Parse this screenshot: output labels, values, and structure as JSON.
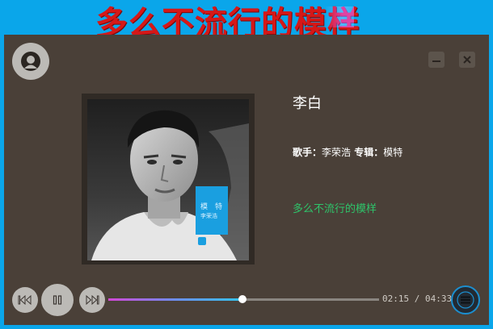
{
  "header": {
    "title": "多么不流行的模样"
  },
  "window": {
    "minimize_icon": "minimize-icon",
    "close_icon": "close-icon",
    "avatar_icon": "user-avatar-icon"
  },
  "song": {
    "title": "李白",
    "singer_label": "歌手：",
    "singer": "李荣浩",
    "album_label": "专辑：",
    "album": "模特",
    "lyric_line": "多么不流行的模样"
  },
  "album_art": {
    "tag_text_1": "模",
    "tag_text_2": "特",
    "tag_text_3": "李荣浩"
  },
  "controls": {
    "prev_icon": "skip-previous-icon",
    "pause_icon": "pause-icon",
    "next_icon": "skip-next-icon",
    "playlist_icon": "playlist-icon"
  },
  "progress": {
    "current": "02:15",
    "separator": "/",
    "total": "04:33",
    "fraction": 0.495
  },
  "colors": {
    "background": "#0aa6ea",
    "panel": "#4a4038",
    "title_red": "#d51818",
    "lyric_green": "#2ec46a",
    "progress_start": "#d347d6",
    "progress_end": "#33c4ee"
  }
}
